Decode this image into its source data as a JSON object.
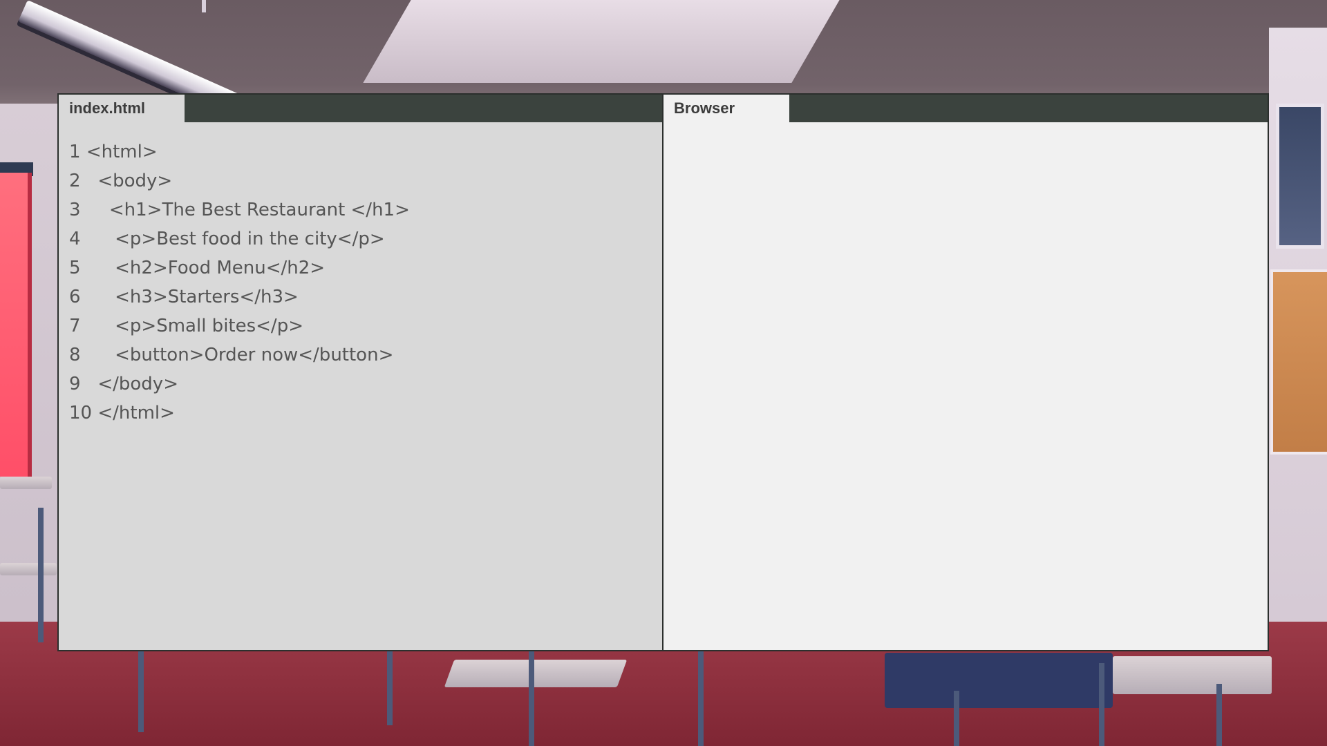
{
  "editor": {
    "tab_label": "index.html",
    "lines": [
      {
        "num": "1",
        "code": "<html>"
      },
      {
        "num": "2",
        "code": "  <body>"
      },
      {
        "num": "3",
        "code": "    <h1>The Best Restaurant </h1>"
      },
      {
        "num": "4",
        "code": "     <p>Best food in the city</p>"
      },
      {
        "num": "5",
        "code": "     <h2>Food Menu</h2>"
      },
      {
        "num": "6",
        "code": "     <h3>Starters</h3>"
      },
      {
        "num": "7",
        "code": "     <p>Small bites</p>"
      },
      {
        "num": "8",
        "code": "     <button>Order now</button>"
      },
      {
        "num": "9",
        "code": "  </body>"
      },
      {
        "num": "10",
        "code": "</html>"
      }
    ]
  },
  "browser": {
    "tab_label": "Browser"
  },
  "colors": {
    "tab_bar": "#3b433e",
    "editor_bg": "#d9d9d9",
    "browser_bg": "#f1f1f1",
    "code_text": "#555555"
  }
}
